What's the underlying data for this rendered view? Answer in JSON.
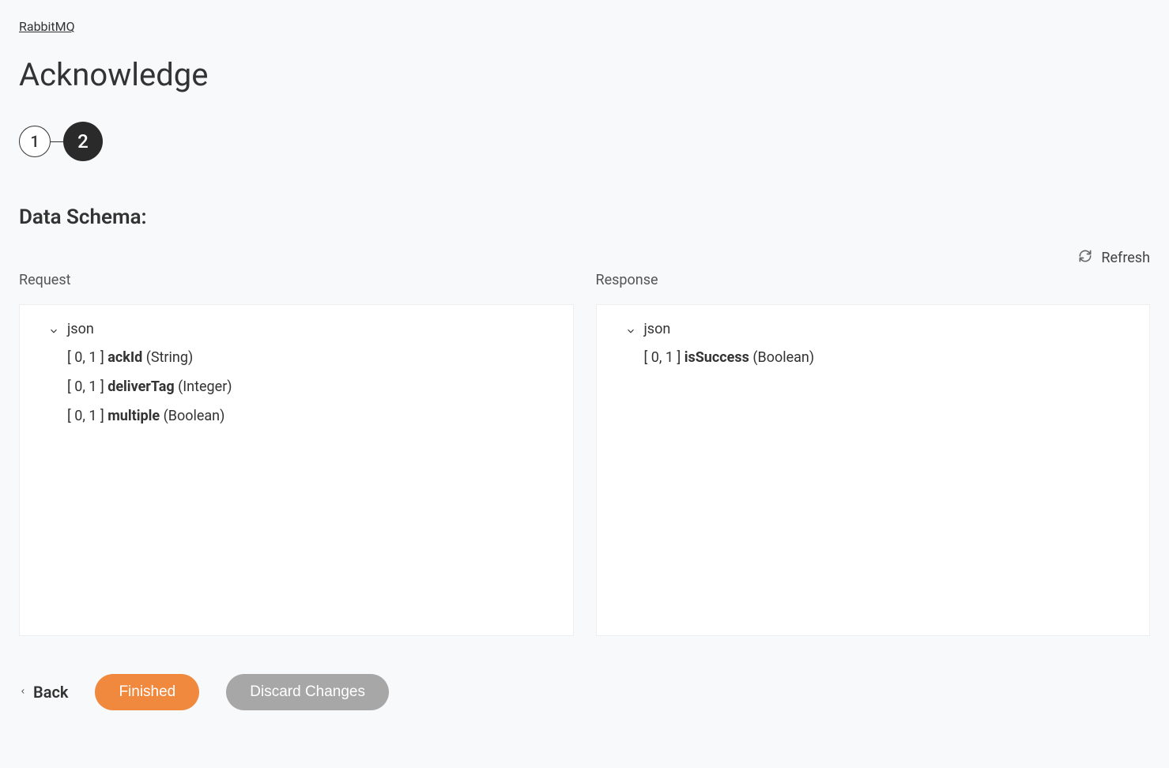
{
  "breadcrumb": "RabbitMQ",
  "title": "Acknowledge",
  "stepper": {
    "step1": "1",
    "step2": "2"
  },
  "sectionTitle": "Data Schema:",
  "refresh": {
    "label": "Refresh"
  },
  "request": {
    "title": "Request",
    "root": "json",
    "fields": [
      {
        "cardinality": "[ 0, 1 ]",
        "name": "ackId",
        "type": "(String)"
      },
      {
        "cardinality": "[ 0, 1 ]",
        "name": "deliverTag",
        "type": "(Integer)"
      },
      {
        "cardinality": "[ 0, 1 ]",
        "name": "multiple",
        "type": "(Boolean)"
      }
    ]
  },
  "response": {
    "title": "Response",
    "root": "json",
    "fields": [
      {
        "cardinality": "[ 0, 1 ]",
        "name": "isSuccess",
        "type": "(Boolean)"
      }
    ]
  },
  "actions": {
    "back": "Back",
    "finished": "Finished",
    "discard": "Discard Changes"
  }
}
